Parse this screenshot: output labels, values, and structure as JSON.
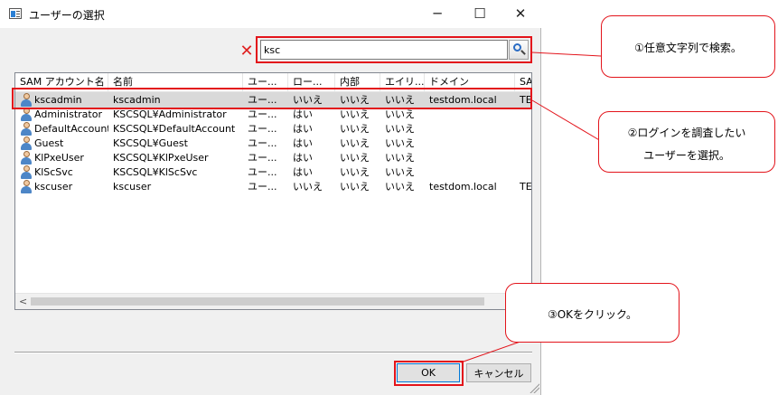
{
  "dialog": {
    "title": "ユーザーの選択",
    "minimize": "─",
    "maximize": "☐",
    "close": "✕"
  },
  "search": {
    "clear_glyph": "✕",
    "value": "ksc"
  },
  "columns": [
    "SAM アカウント名",
    "名前",
    "ユー...",
    "ロー...",
    "内部",
    "エイリ...",
    "ドメイン",
    "SA"
  ],
  "rows": [
    {
      "sam": "kscadmin",
      "name": "kscadmin",
      "type": "ユー...",
      "local": "いいえ",
      "internal": "いいえ",
      "alias": "いいえ",
      "domain": "testdom.local",
      "sa": "TE"
    },
    {
      "sam": "Administrator",
      "name": "KSCSQL¥Administrator",
      "type": "ユー...",
      "local": "はい",
      "internal": "いいえ",
      "alias": "いいえ",
      "domain": "",
      "sa": ""
    },
    {
      "sam": "DefaultAccount",
      "name": "KSCSQL¥DefaultAccount",
      "type": "ユー...",
      "local": "はい",
      "internal": "いいえ",
      "alias": "いいえ",
      "domain": "",
      "sa": ""
    },
    {
      "sam": "Guest",
      "name": "KSCSQL¥Guest",
      "type": "ユー...",
      "local": "はい",
      "internal": "いいえ",
      "alias": "いいえ",
      "domain": "",
      "sa": ""
    },
    {
      "sam": "KlPxeUser",
      "name": "KSCSQL¥KlPxeUser",
      "type": "ユー...",
      "local": "はい",
      "internal": "いいえ",
      "alias": "いいえ",
      "domain": "",
      "sa": ""
    },
    {
      "sam": "KlScSvc",
      "name": "KSCSQL¥KlScSvc",
      "type": "ユー...",
      "local": "はい",
      "internal": "いいえ",
      "alias": "いいえ",
      "domain": "",
      "sa": ""
    },
    {
      "sam": "kscuser",
      "name": "kscuser",
      "type": "ユー...",
      "local": "いいえ",
      "internal": "いいえ",
      "alias": "いいえ",
      "domain": "testdom.local",
      "sa": "TE"
    }
  ],
  "selected_row": 0,
  "scroll_left_glyph": "<",
  "buttons": {
    "ok": "OK",
    "cancel": "キャンセル"
  },
  "callouts": {
    "search": [
      "①任意文字列で検索。"
    ],
    "select": [
      "②ログインを調査したい",
      "ユーザーを選択。"
    ],
    "ok": [
      "③OKをクリック。"
    ]
  },
  "colors": {
    "annotation": "#e3141b",
    "selection": "#d9d9d9"
  }
}
